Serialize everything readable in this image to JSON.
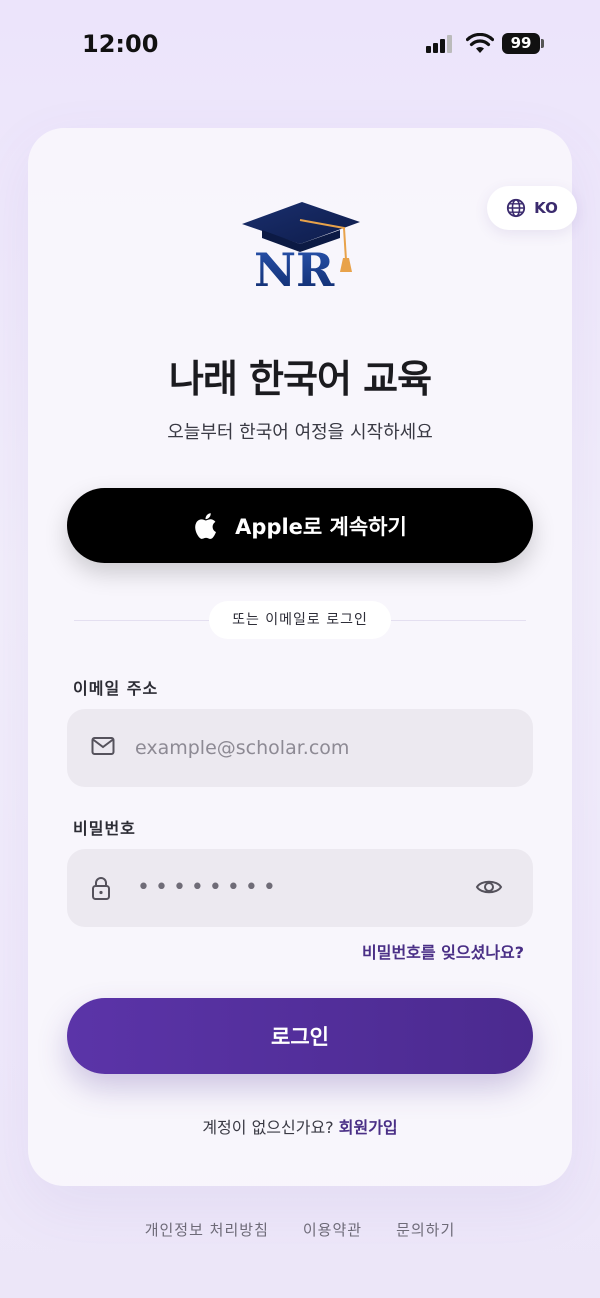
{
  "status_bar": {
    "time": "12:00",
    "battery": "99"
  },
  "language": {
    "code": "KO"
  },
  "header": {
    "title": "나래 한국어 교육",
    "subtitle": "오늘부터 한국어 여정을 시작하세요"
  },
  "apple_button": {
    "label": "Apple로 계속하기"
  },
  "divider": {
    "text": "또는 이메일로 로그인"
  },
  "email": {
    "label": "이메일 주소",
    "placeholder": "example@scholar.com"
  },
  "password": {
    "label": "비밀번호",
    "masked_value": "••••••••"
  },
  "forgot_password": "비밀번호를 잊으셨나요?",
  "login_button": {
    "label": "로그인"
  },
  "signup": {
    "prompt": "계정이 없으신가요?",
    "link": "회원가입"
  },
  "footer": {
    "privacy": "개인정보 처리방침",
    "terms": "이용약관",
    "contact": "문의하기"
  },
  "colors": {
    "accent": "#4a2f86",
    "login_gradient_start": "#5b34a8",
    "login_gradient_end": "#4b2a8f",
    "apple_button": "#000000"
  },
  "icons": {
    "language": "globe-icon",
    "apple": "apple-icon",
    "email": "mail-icon",
    "password": "lock-icon",
    "toggle_visibility": "eye-icon"
  }
}
